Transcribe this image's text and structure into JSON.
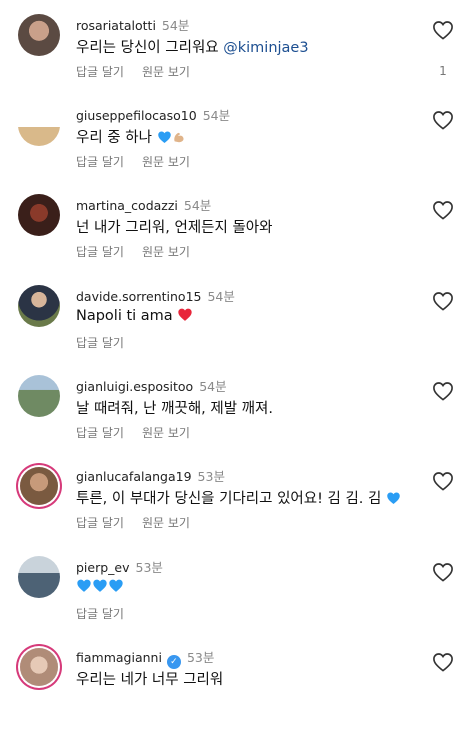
{
  "labels": {
    "reply": "답글 달기",
    "see_translation": "원문 보기"
  },
  "comments": [
    {
      "username": "rosariatalotti",
      "time": "54분",
      "text": "우리는 당신이 그리워요",
      "mention": "@kiminjae3",
      "likes": "1",
      "avatar_color": "#5b4a42"
    },
    {
      "username": "giuseppefilocaso10",
      "time": "54분",
      "text": "우리 중 하나",
      "avatar_color": "#d9b98a"
    },
    {
      "username": "martina_codazzi",
      "time": "54분",
      "text": "넌 내가 그리워, 언제든지 돌아와",
      "avatar_color": "#3a1f1a"
    },
    {
      "username": "davide.sorrentino15",
      "time": "54분",
      "text": "Napoli ti ama",
      "avatar_color": "#4b5a3a"
    },
    {
      "username": "gianluigi.espositoo",
      "time": "54분",
      "text": "날 때려줘, 난 깨끗해, 제발 깨져.",
      "avatar_color": "#6f8a63"
    },
    {
      "username": "gianlucafalanga19",
      "time": "53분",
      "text": "투른, 이 부대가 당신을 기다리고 있어요! 김 김. 김",
      "avatar_color": "#7a5a40"
    },
    {
      "username": "pierp_ev",
      "time": "53분",
      "text": "",
      "avatar_color": "#4d6275"
    },
    {
      "username": "fiammagianni",
      "time": "53분",
      "text": "우리는 네가 너무 그리워",
      "avatar_color": "#b08c78"
    }
  ]
}
